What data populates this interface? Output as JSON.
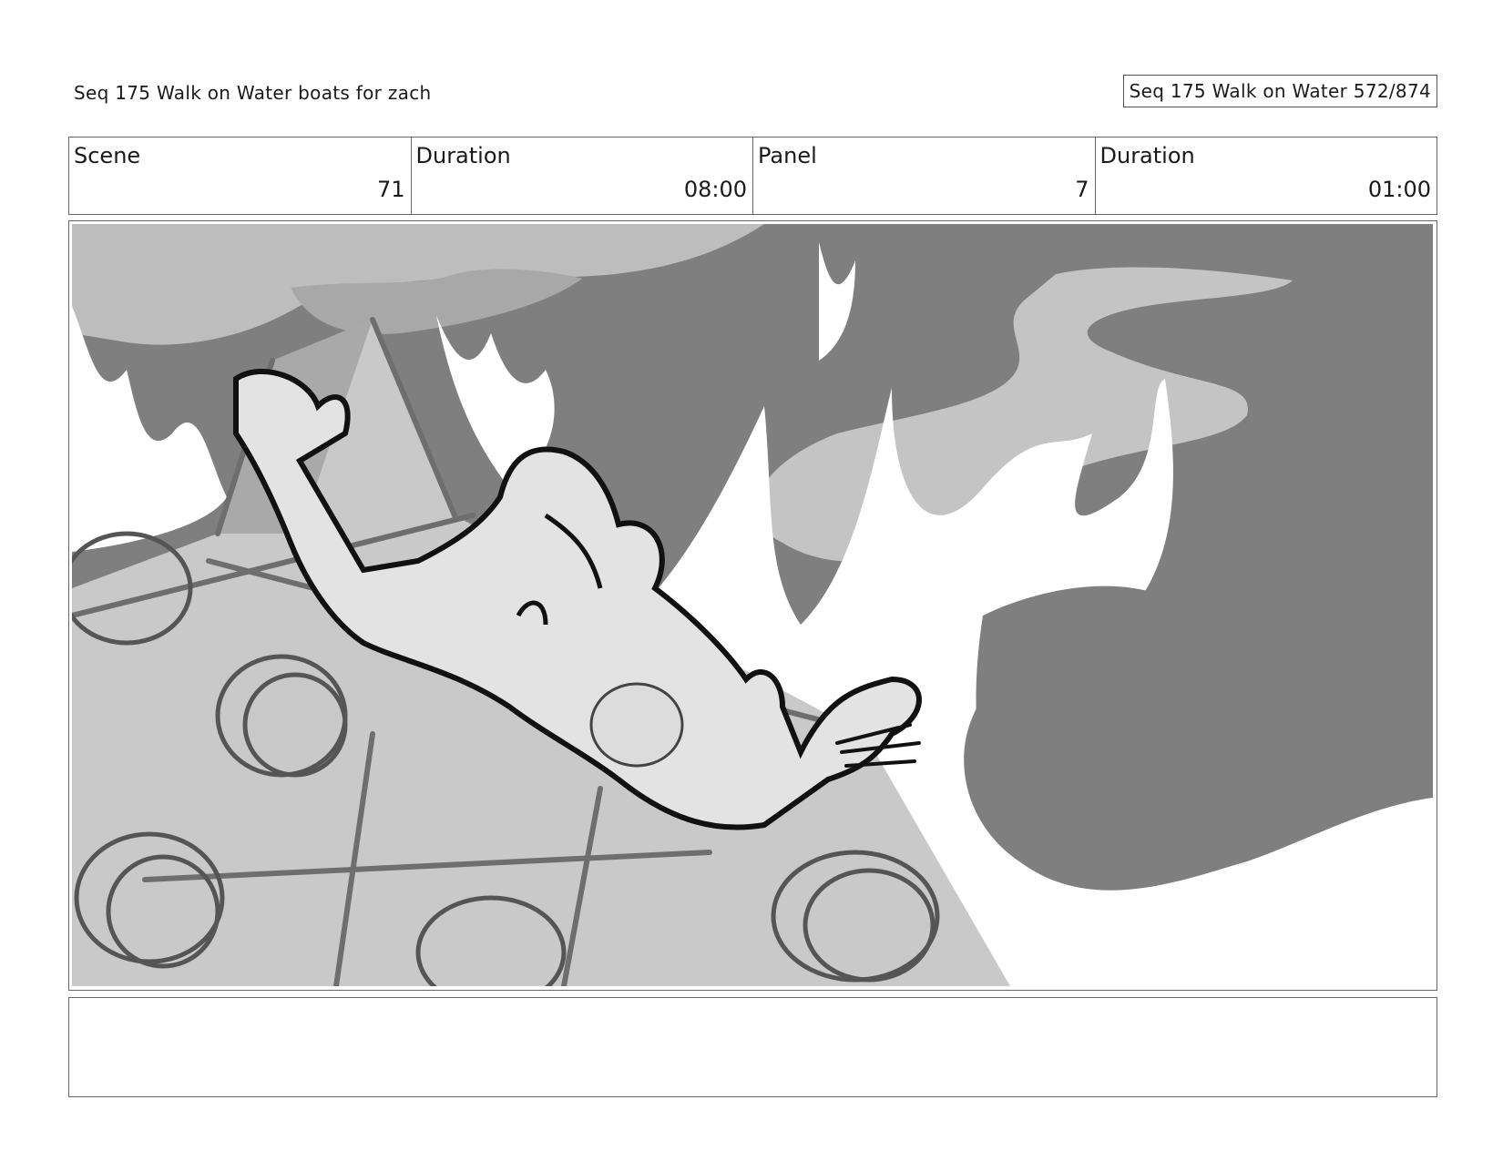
{
  "header": {
    "title": "Seq 175 Walk on Water  boats for zach",
    "page_counter": "Seq 175 Walk on Water 572/874"
  },
  "info": {
    "scene_label": "Scene",
    "scene_value": "71",
    "scene_duration_label": "Duration",
    "scene_duration_value": "08:00",
    "panel_label": "Panel",
    "panel_value": "7",
    "panel_duration_label": "Duration",
    "panel_duration_value": "01:00"
  },
  "notes": {
    "text": ""
  }
}
